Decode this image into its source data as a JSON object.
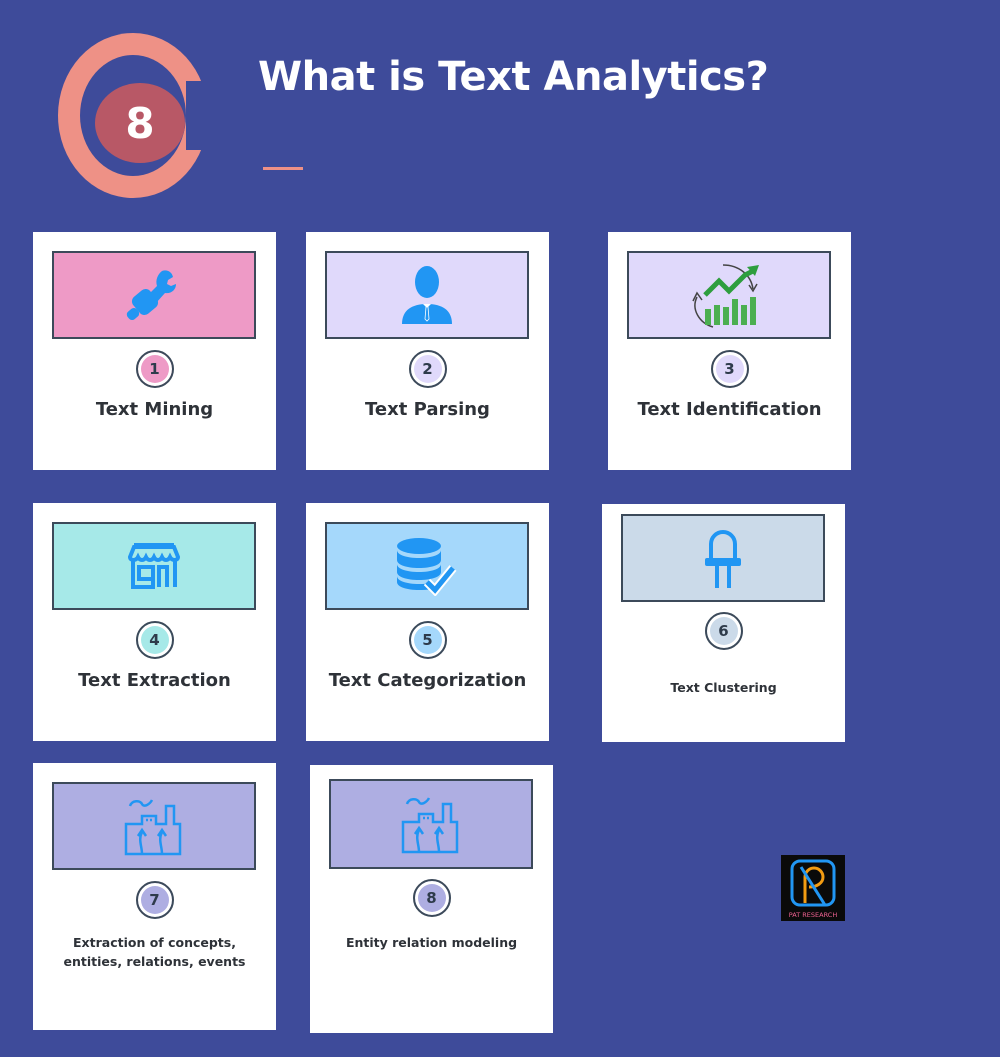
{
  "header": {
    "badge_number": "8",
    "title": "What is Text Analytics?"
  },
  "colors": {
    "background": "#3e4b9a",
    "accent": "#ee9186",
    "badge_core": "#b85866",
    "icon_blue": "#2196f3"
  },
  "cards": [
    {
      "number": "1",
      "label": "Text Mining",
      "icon": "hand-wrench-icon",
      "color": "#ee9ac6"
    },
    {
      "number": "2",
      "label": "Text Parsing",
      "icon": "businessman-icon",
      "color": "#e0d9fb"
    },
    {
      "number": "3",
      "label": "Text Identification",
      "icon": "growth-chart-icon",
      "color": "#e0d9fb"
    },
    {
      "number": "4",
      "label": "Text Extraction",
      "icon": "storefront-icon",
      "color": "#a6e9e8"
    },
    {
      "number": "5",
      "label": "Text Categorization",
      "icon": "database-check-icon",
      "color": "#a5d8fb"
    },
    {
      "number": "6",
      "label": "Text Clustering",
      "icon": "led-icon",
      "color": "#cbdae9"
    },
    {
      "number": "7",
      "label": "Extraction of concepts, entities, relations, events",
      "icon": "factory-icon",
      "color": "#aeaee2"
    },
    {
      "number": "8",
      "label": "Entity relation modeling",
      "icon": "factory-icon",
      "color": "#aeaee2"
    }
  ],
  "logo": {
    "text": "PAT RESEARCH"
  }
}
